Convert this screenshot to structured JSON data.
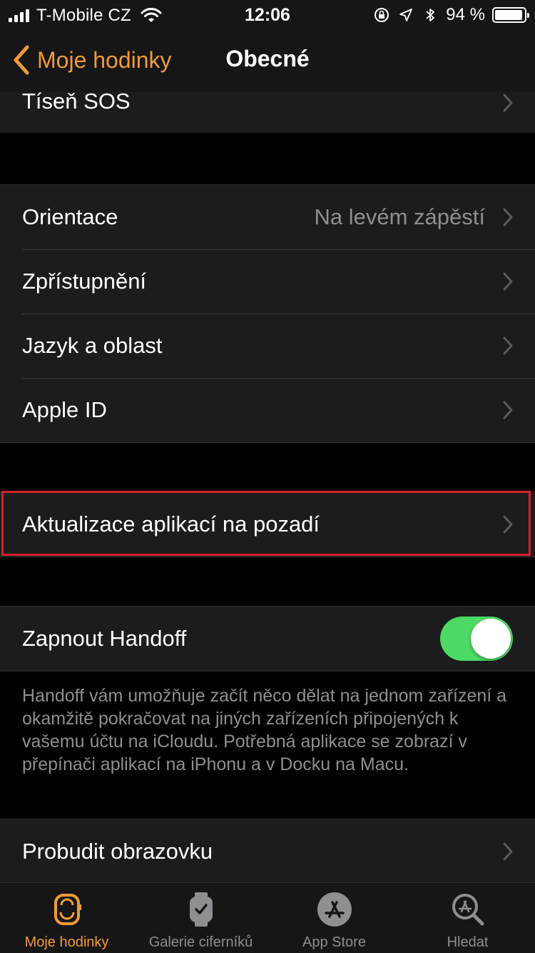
{
  "status_bar": {
    "carrier": "T-Mobile CZ",
    "time": "12:06",
    "battery_percent": "94 %",
    "battery_level": 0.94
  },
  "nav": {
    "back_label": "Moje hodinky",
    "title": "Obecné"
  },
  "rows": {
    "sos": "Tíseň SOS",
    "orientation": "Orientace",
    "orientation_value": "Na levém zápěstí",
    "accessibility": "Zpřístupnění",
    "language": "Jazyk a oblast",
    "apple_id": "Apple ID",
    "background_refresh": "Aktualizace aplikací na pozadí",
    "handoff": "Zapnout Handoff",
    "handoff_on": true,
    "handoff_footer": "Handoff vám umožňuje začít něco dělat na jednom zařízení a okamžitě pokračovat na jiných zařízeních připojených k vašemu účtu na iCloudu. Potřebná aplikace se zobrazí v přepínači aplikací na iPhonu a v Docku na Macu.",
    "wake_screen": "Probudit obrazovku"
  },
  "tabs": [
    {
      "label": "Moje hodinky",
      "icon": "watch-icon",
      "active": true
    },
    {
      "label": "Galerie ciferníků",
      "icon": "watch-face-gallery-icon",
      "active": false
    },
    {
      "label": "App Store",
      "icon": "app-store-icon",
      "active": false
    },
    {
      "label": "Hledat",
      "icon": "search-icon",
      "active": false
    }
  ],
  "colors": {
    "accent": "#f19a38",
    "toggle_on": "#4cd964",
    "highlight": "#d9202b",
    "secondary_text": "#8e8e93"
  }
}
